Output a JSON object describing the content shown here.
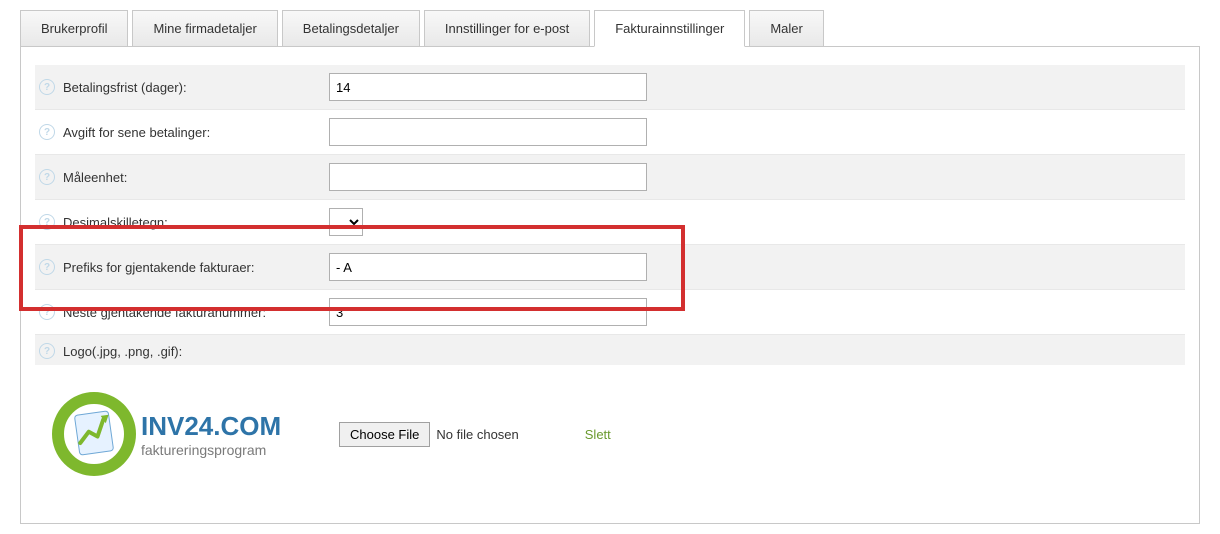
{
  "tabs": [
    {
      "label": "Brukerprofil",
      "active": false
    },
    {
      "label": "Mine firmadetaljer",
      "active": false
    },
    {
      "label": "Betalingsdetaljer",
      "active": false
    },
    {
      "label": "Innstillinger for e-post",
      "active": false
    },
    {
      "label": "Fakturainnstillinger",
      "active": true
    },
    {
      "label": "Maler",
      "active": false
    }
  ],
  "fields": {
    "payment_deadline": {
      "label": "Betalingsfrist (dager):",
      "value": "14"
    },
    "late_fee": {
      "label": "Avgift for sene betalinger:",
      "value": ""
    },
    "unit": {
      "label": "Måleenhet:",
      "value": ""
    },
    "decimal_separator": {
      "label": "Desimalskilletegn:",
      "value": ","
    },
    "recurring_prefix": {
      "label": "Prefiks for gjentakende fakturaer:",
      "value": "- A"
    },
    "next_recurring_number": {
      "label": "Neste gjentakende fakturanummer:",
      "value": "3"
    },
    "logo": {
      "label": "Logo(.jpg, .png, .gif):"
    }
  },
  "file_control": {
    "choose_label": "Choose File",
    "no_file_text": "No file chosen",
    "delete_label": "Slett"
  },
  "logo_image": {
    "brand_text": "INV24.COM",
    "subtitle": "faktureringsprogram"
  }
}
